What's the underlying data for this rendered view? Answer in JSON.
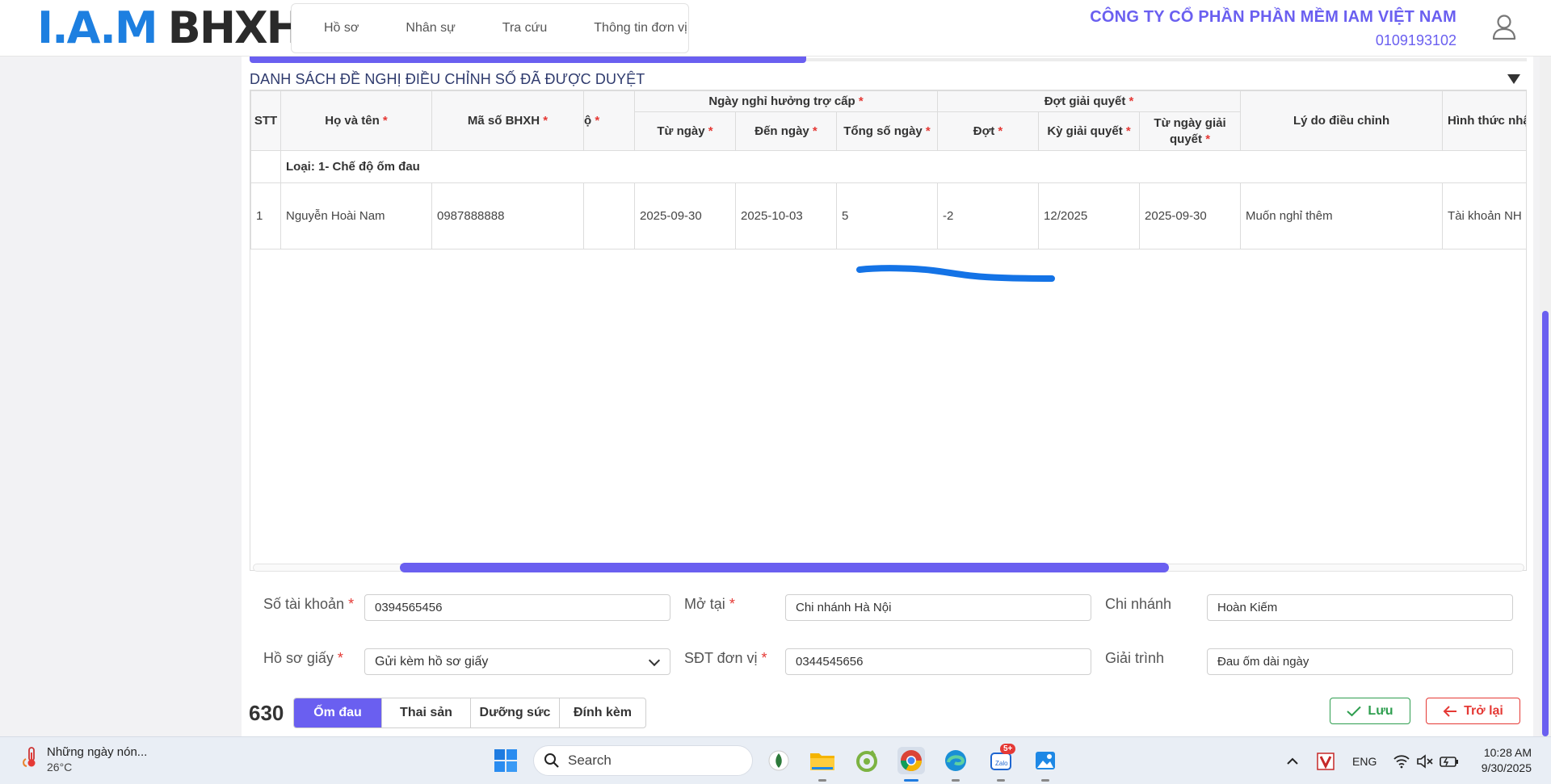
{
  "header": {
    "logo_part1": "I.A.M",
    "logo_part2": "BHXH",
    "nav": [
      "Hồ sơ",
      "Nhân sự",
      "Tra cứu",
      "Thông tin đơn vị"
    ],
    "company_name": "CÔNG TY CỔ PHẦN PHẦN MỀM IAM VIỆT NAM",
    "company_code": "0109193102"
  },
  "section": {
    "title": "DANH SÁCH ĐỀ NGHỊ ĐIỀU CHỈNH SỐ ĐÃ ĐƯỢC DUYỆT"
  },
  "table": {
    "headers": {
      "stt": "STT",
      "name": "Họ và tên",
      "bhxh": "Mã số BHXH",
      "regime_partial": "ộ",
      "leave_group": "Ngày nghỉ hưởng trợ cấp",
      "from": "Từ ngày",
      "to": "Đến ngày",
      "total": "Tổng số ngày",
      "batch_group": "Đợt giải quyết",
      "batch": "Đợt",
      "period": "Kỳ giải quyết",
      "from_resolve_line1": "Từ ngày giải",
      "from_resolve_line2": "quyết",
      "reason": "Lý do điều chỉnh",
      "payment": "Hình thức nhậ"
    },
    "required_mark": "*",
    "group_label": "Loại: 1- Chế độ ốm đau",
    "rows": [
      {
        "stt": "1",
        "name": "Nguyễn Hoài Nam",
        "bhxh": "0987888888",
        "regime": "",
        "from": "2025-09-30",
        "to": "2025-10-03",
        "total": "5",
        "batch": "-2",
        "period": "12/2025",
        "from_resolve": "2025-09-30",
        "reason": "Muốn nghỉ thêm",
        "payment": "Tài khoản NH"
      }
    ]
  },
  "form": {
    "account_label": "Số tài khoản",
    "account_value": "0394565456",
    "opened_at_label": "Mở tại",
    "opened_at_value": "Chi nhánh Hà Nội",
    "branch_label": "Chi nhánh",
    "branch_value": "Hoàn Kiếm",
    "paper_label": "Hồ sơ giấy",
    "paper_value": "Gửi kèm hồ sơ giấy",
    "phone_label": "SĐT đơn vị",
    "phone_value": "0344545656",
    "explain_label": "Giải trình",
    "explain_value": "Đau ốm dài ngày"
  },
  "footer": {
    "count": "630",
    "tabs": [
      "Ốm đau",
      "Thai sản",
      "Dưỡng sức",
      "Đính kèm"
    ],
    "active_tab": "Ốm đau",
    "save_label": "Lưu",
    "back_label": "Trở lại"
  },
  "taskbar": {
    "weather_title": "Những ngày nón...",
    "weather_temp": "26°C",
    "search_placeholder": "Search",
    "zalo_badge": "5+",
    "lang": "ENG",
    "time": "10:28 AM",
    "date": "9/30/2025"
  },
  "colors": {
    "accent": "#6a5ff0",
    "logo_blue": "#1d7fe0",
    "required": "#e53935",
    "save_green": "#2e9e4f",
    "annotation_stroke": "#1473e6"
  },
  "icons": [
    "user-icon",
    "collapse-triangle-icon",
    "chevron-down-icon",
    "check-icon",
    "arrow-left-icon",
    "windows-start-icon",
    "search-icon",
    "wifi-icon",
    "volume-mute-icon",
    "battery-icon"
  ]
}
